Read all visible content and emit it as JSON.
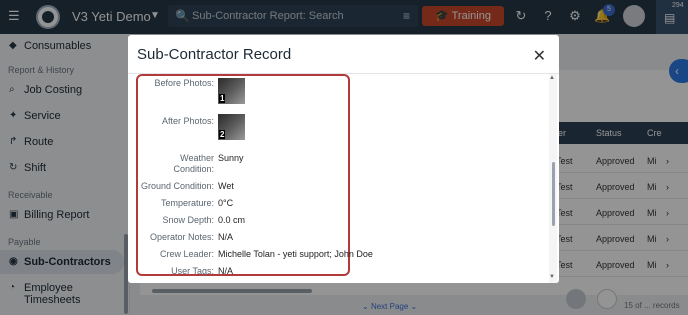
{
  "topbar": {
    "collapse_icon": "collapse-icon",
    "app_title": "V3 Yeti Demo",
    "search_placeholder": "Sub-Contractor Report: Search",
    "training_label": "Training",
    "notification_count": "5",
    "chat_count": "294"
  },
  "sidebar": {
    "items_top": [
      {
        "label": "Consumables",
        "icon": "box-icon"
      }
    ],
    "section_report": "Report & History",
    "report_items": [
      {
        "label": "Job Costing",
        "icon": "search-icon"
      },
      {
        "label": "Service",
        "icon": "wrench-icon"
      },
      {
        "label": "Route",
        "icon": "route-icon"
      },
      {
        "label": "Shift",
        "icon": "shift-icon"
      }
    ],
    "section_receivable": "Receivable",
    "receivable_items": [
      {
        "label": "Billing Report",
        "icon": "report-icon"
      }
    ],
    "section_payable": "Payable",
    "payable_items": [
      {
        "label": "Sub-Contractors",
        "icon": "subcontractor-icon",
        "active": true
      },
      {
        "label": "Employee Timesheets",
        "icon": "timesheet-icon"
      }
    ]
  },
  "background": {
    "headers": [
      "er",
      "Status",
      "Cre"
    ],
    "rows": [
      {
        "c1": "Test",
        "status": "Approved",
        "c3": "Mi"
      },
      {
        "c1": "Test",
        "status": "Approved",
        "c3": "Mi"
      },
      {
        "c1": "Test",
        "status": "Approved",
        "c3": "Mi"
      },
      {
        "c1": "Test",
        "status": "Approved",
        "c3": "Mi"
      },
      {
        "c1": "Test",
        "status": "Approved",
        "c3": "Mi"
      }
    ],
    "next_page": "Next Page",
    "records": "15 of ... records"
  },
  "modal": {
    "title": "Sub-Contractor Record",
    "before_photos_label": "Before Photos:",
    "before_photo_number": "1",
    "after_photos_label": "After Photos:",
    "after_photo_number": "2",
    "fields": [
      {
        "label": "Weather Condition:",
        "value": "Sunny"
      },
      {
        "label": "Ground Condition:",
        "value": "Wet"
      },
      {
        "label": "Temperature:",
        "value": "0°C"
      },
      {
        "label": "Snow Depth:",
        "value": "0.0 cm"
      },
      {
        "label": "Operator Notes:",
        "value": "N/A"
      },
      {
        "label": "Crew Leader:",
        "value": "Michelle Tolan - yeti support; John Doe"
      },
      {
        "label": "User Tags:",
        "value": "N/A"
      }
    ]
  },
  "colors": {
    "topbar": "#253746",
    "training": "#c8472c",
    "highlight_border": "#b33a3a",
    "accent_blue": "#2c7be5"
  }
}
